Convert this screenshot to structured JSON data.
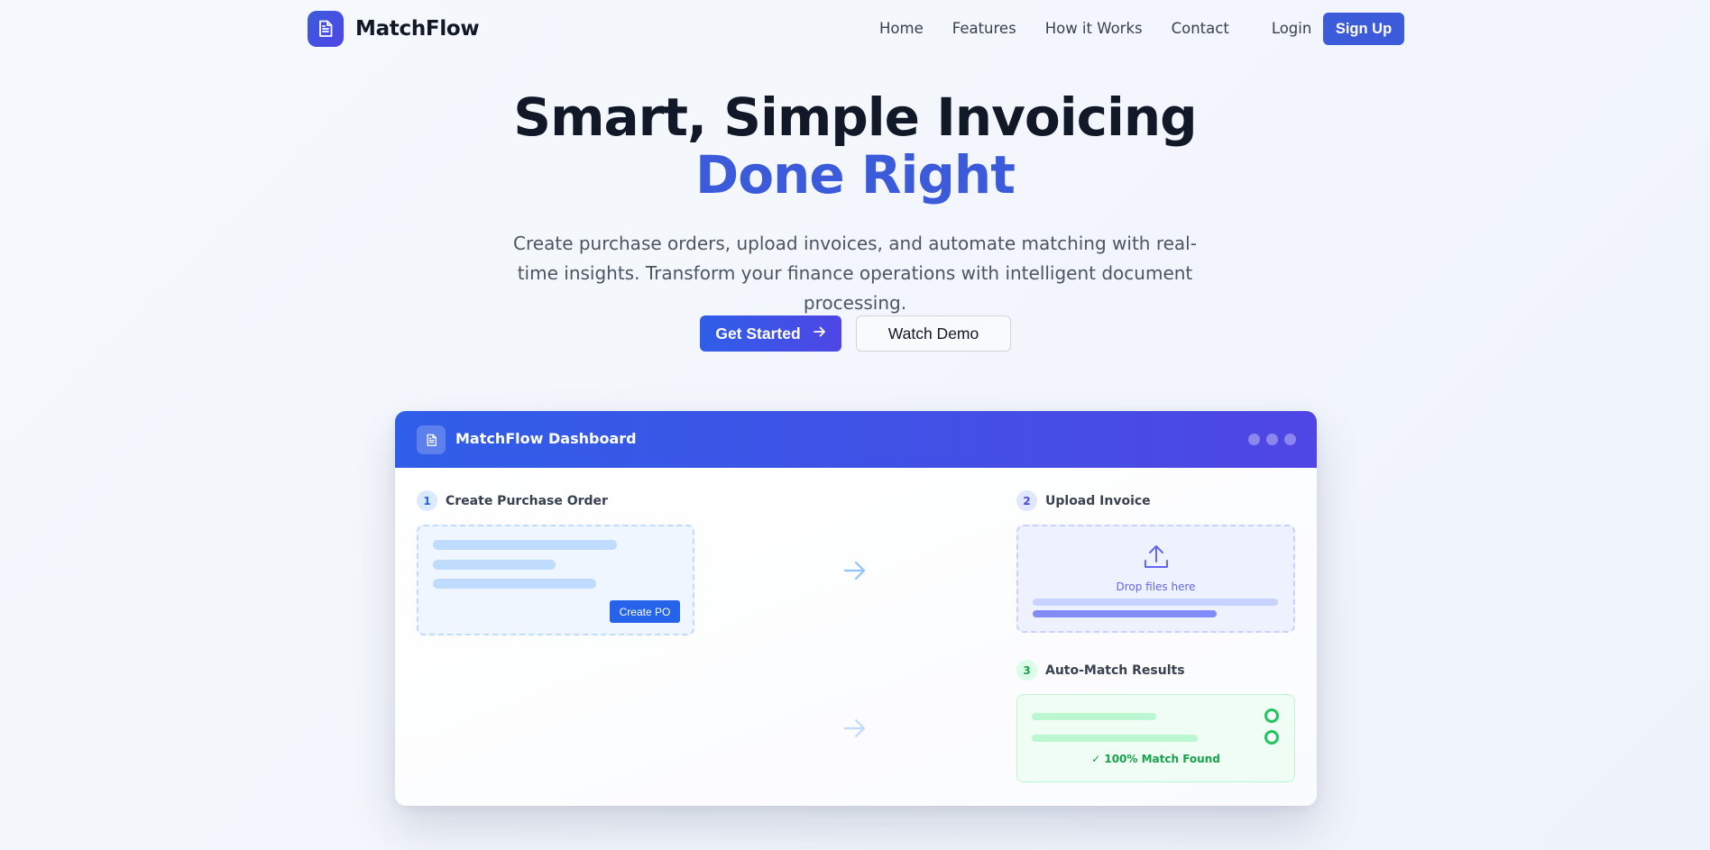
{
  "brand": {
    "name": "MatchFlow",
    "logo_icon": "document-icon"
  },
  "nav": {
    "items": [
      "Home",
      "Features",
      "How it Works",
      "Contact"
    ],
    "login": "Login",
    "signup": "Sign Up"
  },
  "hero": {
    "title_line1": "Smart, Simple Invoicing",
    "title_line2": "Done Right",
    "subtitle": "Create purchase orders, upload invoices, and automate matching with real-time insights. Transform your finance operations with intelligent document processing.",
    "primary_cta": "Get Started",
    "primary_cta_icon": "arrow-right-icon",
    "secondary_cta": "Watch Demo"
  },
  "dashboard": {
    "title": "MatchFlow Dashboard",
    "steps": [
      {
        "num": "1",
        "label": "Create Purchase Order",
        "button": "Create PO"
      },
      {
        "num": "2",
        "label": "Upload Invoice",
        "drop_text": "Drop files here",
        "upload_icon": "upload-icon"
      },
      {
        "num": "3",
        "label": "Auto-Match Results",
        "result": "✓ 100% Match Found"
      }
    ]
  },
  "colors": {
    "accent": "#3b5bdb",
    "accent_indigo": "#4f46e5",
    "success": "#16a34a",
    "text_dark": "#111827"
  }
}
